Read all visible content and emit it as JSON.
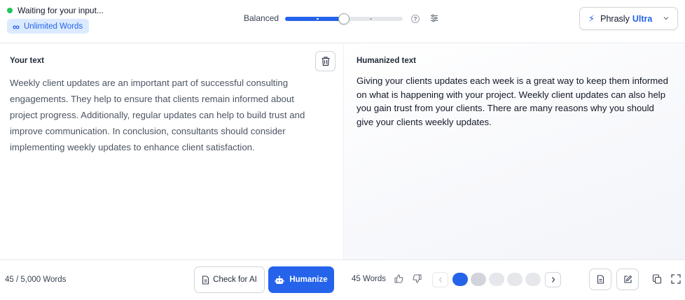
{
  "status": {
    "text": "Waiting for your input...",
    "color": "#22c55e"
  },
  "plan_badge": {
    "icon": "infinity-icon",
    "label": "Unlimited Words"
  },
  "mode": {
    "label": "Balanced",
    "level": 0.5
  },
  "model": {
    "name": "Phrasly",
    "tier": "Ultra",
    "accent": "#2563eb"
  },
  "input_panel": {
    "title": "Your text",
    "text": "Weekly client updates are an important part of successful consulting engagements. They help to ensure that clients remain informed about project progress. Additionally, regular updates can help to build trust and improve communication. In conclusion, consultants should consider implementing weekly updates to enhance client satisfaction."
  },
  "output_panel": {
    "title": "Humanized text",
    "text": "Giving your clients updates each week is a great way to keep them informed on what is happening with your project. Weekly client updates can also help you gain trust from your clients. There are many reasons why you should give your clients weekly updates."
  },
  "footer": {
    "input_word_count": "45 / 5,000 Words",
    "check_label": "Check for AI",
    "humanize_label": "Humanize",
    "output_word_count": "45 Words",
    "pager": {
      "current": 1,
      "total": 5
    }
  },
  "colors": {
    "primary": "#2563eb",
    "badge_bg": "#dbeafe"
  }
}
